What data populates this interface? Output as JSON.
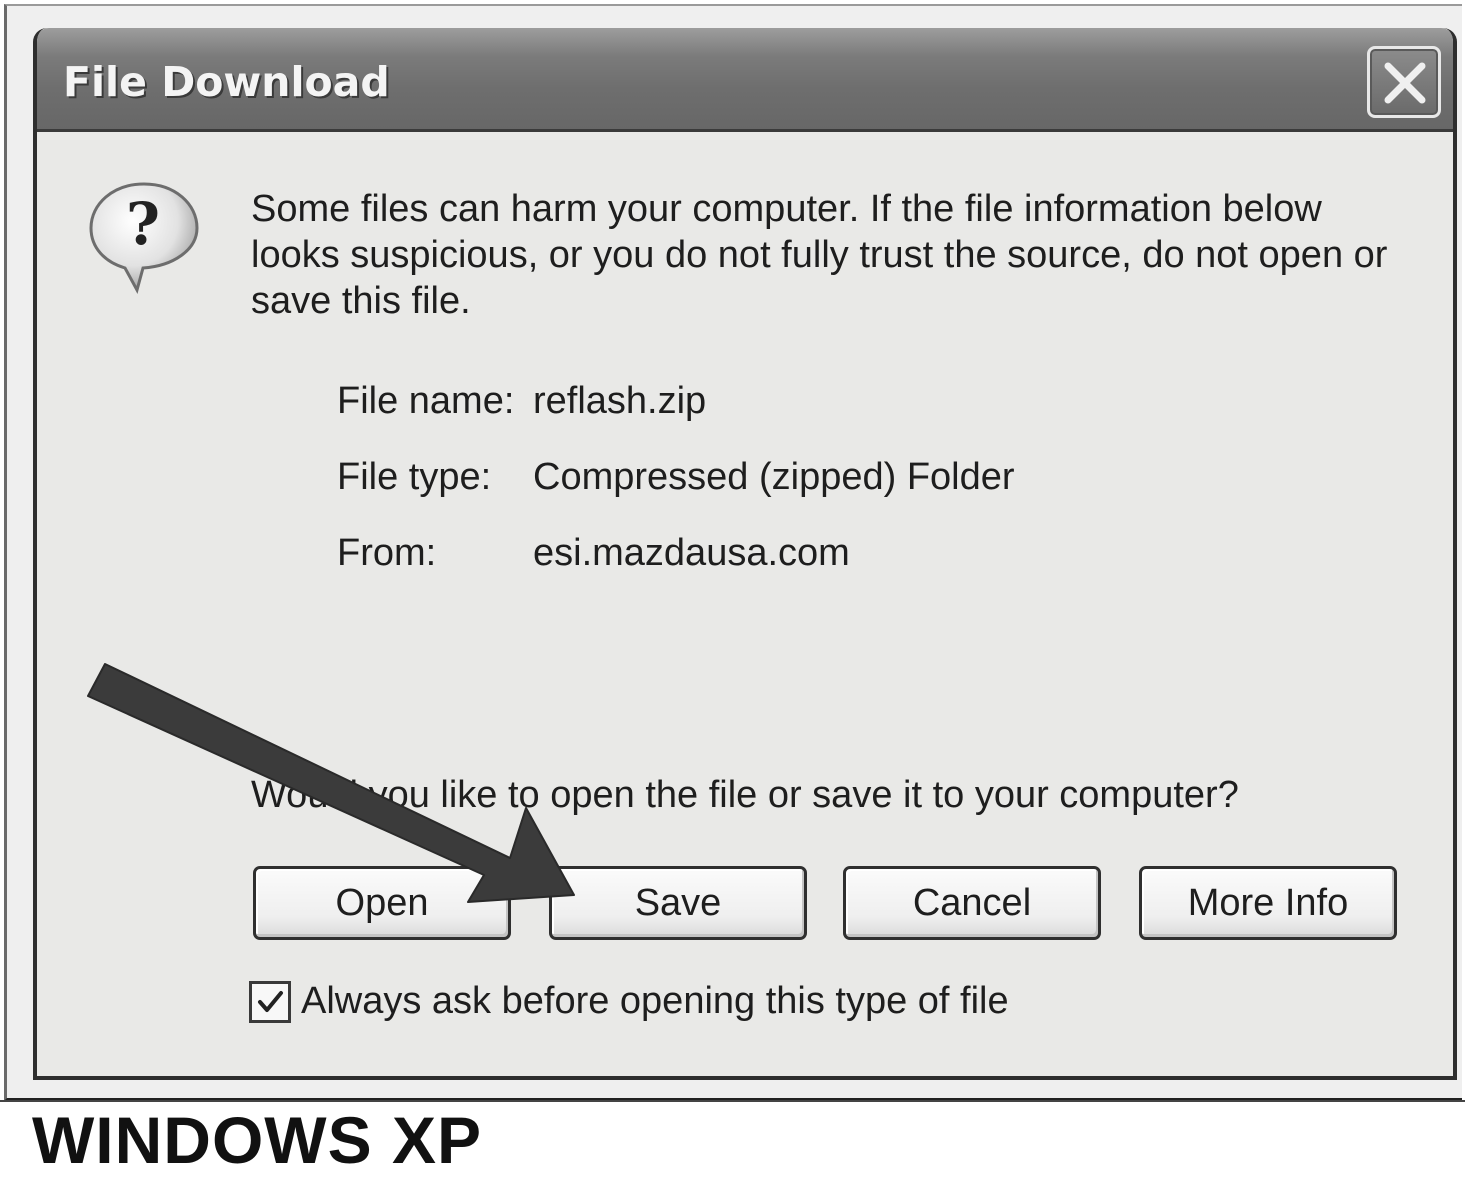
{
  "dialog": {
    "title": "File Download",
    "close_icon": "close-icon",
    "question_icon": "question-mark-icon",
    "message": "Some files can harm your computer. If the file information below looks suspicious, or you do not fully trust the source, do not open or save this file.",
    "file_info": {
      "name_label": "File name:",
      "name_value": "reflash.zip",
      "type_label": "File type:",
      "type_value": "Compressed (zipped) Folder",
      "from_label": "From:",
      "from_value": "esi.mazdausa.com"
    },
    "question": "Would you like to open the file or save it to your computer?",
    "buttons": {
      "open": "Open",
      "save": "Save",
      "cancel": "Cancel",
      "more_info": "More Info"
    },
    "checkbox": {
      "label": "Always ask before opening this type of file",
      "checked": true
    }
  },
  "annotation": {
    "arrow_icon": "arrow-pointer-icon",
    "target": "Save"
  },
  "caption": "WINDOWS XP"
}
